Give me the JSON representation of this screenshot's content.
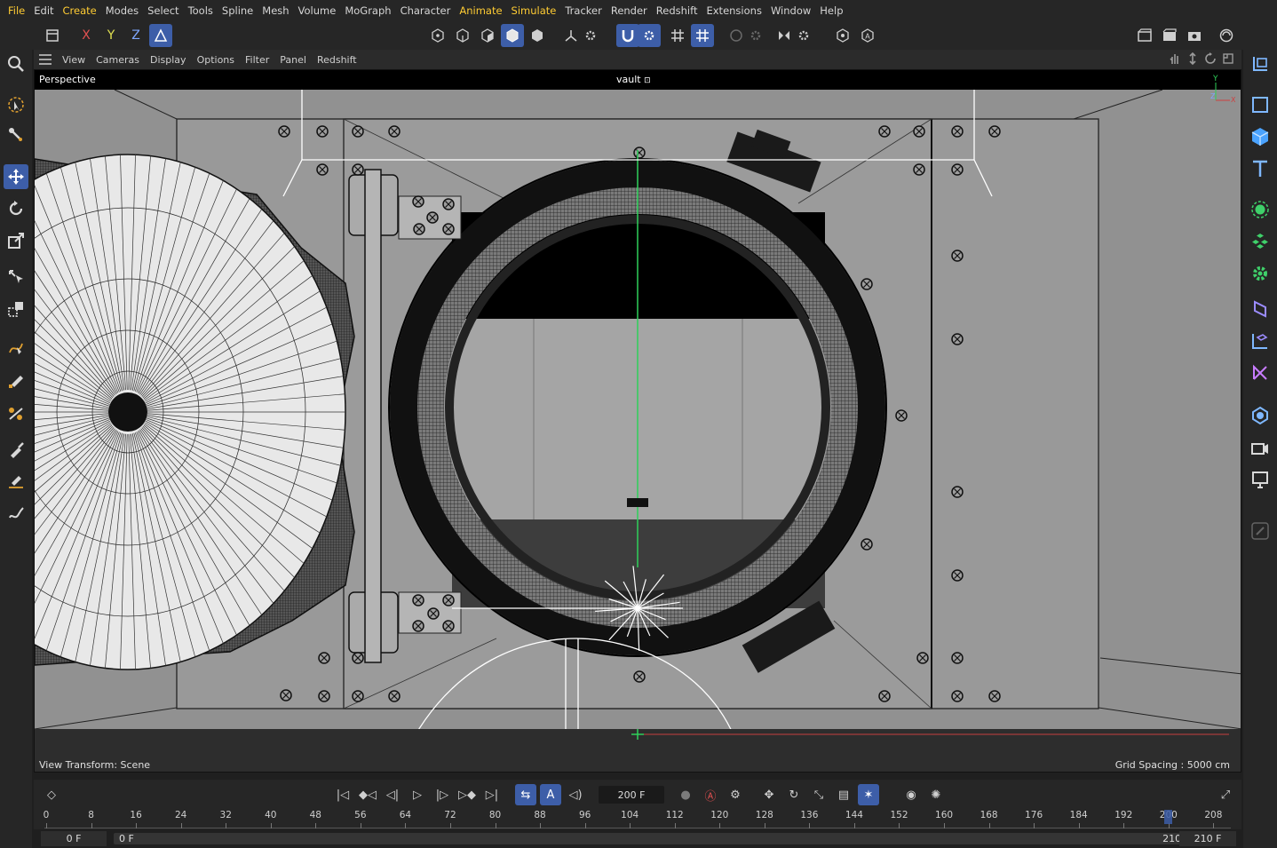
{
  "menu": {
    "items": [
      "File",
      "Edit",
      "Create",
      "Modes",
      "Select",
      "Tools",
      "Spline",
      "Mesh",
      "Volume",
      "MoGraph",
      "Character",
      "Animate",
      "Simulate",
      "Tracker",
      "Render",
      "Redshift",
      "Extensions",
      "Window",
      "Help"
    ]
  },
  "toolbar": {
    "axis_x": "X",
    "axis_y": "Y",
    "axis_z": "Z"
  },
  "viewport_menu": {
    "items": [
      "View",
      "Cameras",
      "Display",
      "Options",
      "Filter",
      "Panel",
      "Redshift"
    ]
  },
  "viewport": {
    "projection": "Perspective",
    "camera_name": "vault",
    "view_transform": "View Transform: Scene",
    "grid_spacing": "Grid Spacing : 5000 cm",
    "axis_y_label": "Y",
    "axis_z_label": "Z",
    "axis_x_label": "X"
  },
  "timeline": {
    "current_frame": "200 F",
    "ruler_labels": [
      "0",
      "8",
      "16",
      "24",
      "32",
      "40",
      "48",
      "56",
      "64",
      "72",
      "80",
      "88",
      "96",
      "104",
      "112",
      "120",
      "128",
      "136",
      "144",
      "152",
      "160",
      "168",
      "176",
      "184",
      "192",
      "200",
      "208"
    ],
    "playhead_frame": 200,
    "max_frame": 210
  },
  "range": {
    "start": "0 F",
    "range_start": "0 F",
    "range_end": "210 F",
    "end": "210 F"
  },
  "colors": {
    "accent_blue": "#3d5ea8",
    "menu_accent": "#ffcc33",
    "viewport_bg": "#919191",
    "axis_green": "#2fd05a",
    "axis_red": "#d04040"
  }
}
